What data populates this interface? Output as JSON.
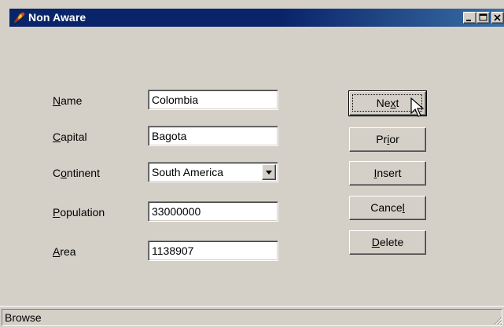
{
  "window": {
    "title": "Non Aware"
  },
  "form": {
    "fields": [
      {
        "accel": "N",
        "rest": "ame",
        "value": "Colombia"
      },
      {
        "accel": "C",
        "rest": "apital",
        "value": "Bagota"
      },
      {
        "pre": "C",
        "accel": "o",
        "rest": "ntinent",
        "value": "South America"
      },
      {
        "accel": "P",
        "rest": "opulation",
        "value": "33000000"
      },
      {
        "accel": "A",
        "rest": "rea",
        "value": "1138907"
      }
    ]
  },
  "buttons": {
    "next": {
      "pre": "Ne",
      "accel": "x",
      "rest": "t"
    },
    "prior": {
      "pre": "Pr",
      "accel": "i",
      "rest": "or"
    },
    "insert": {
      "pre": "",
      "accel": "I",
      "rest": "nsert"
    },
    "cancel": {
      "pre": "Cance",
      "accel": "l",
      "rest": ""
    },
    "delete": {
      "pre": "",
      "accel": "D",
      "rest": "elete"
    }
  },
  "status": {
    "text": "Browse"
  },
  "colors": {
    "titlebar": "#0a246a",
    "face": "#d4d0c8"
  }
}
